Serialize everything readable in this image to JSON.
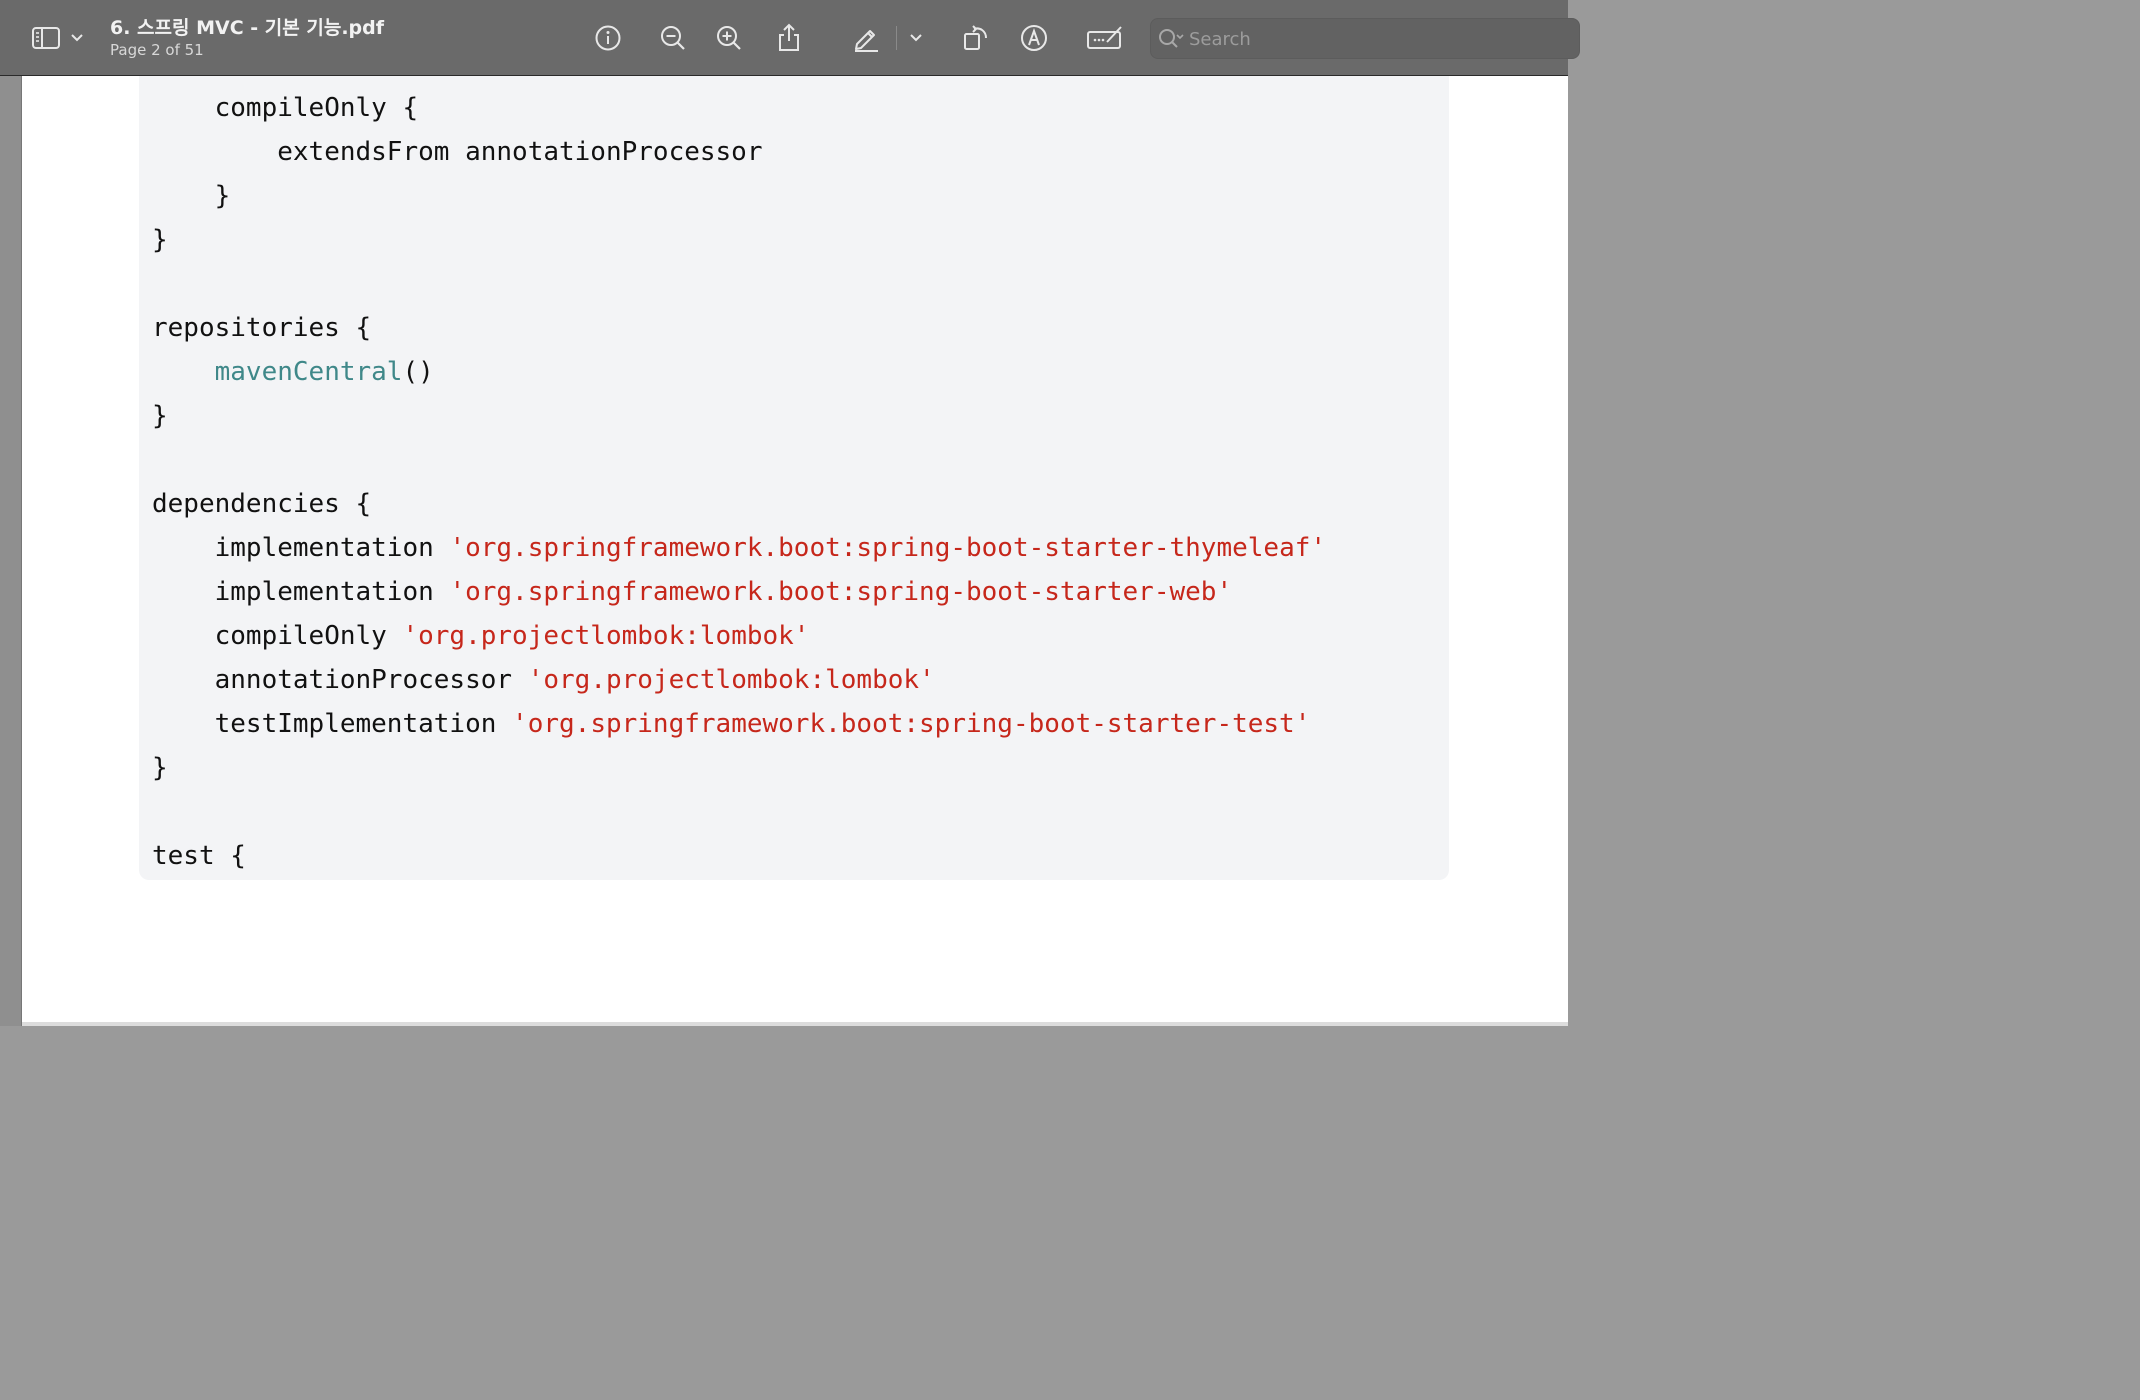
{
  "toolbar": {
    "document_title": "6. 스프링 MVC - 기본 기능.pdf",
    "page_indicator": "Page 2 of 51",
    "search_placeholder": "Search"
  },
  "code": {
    "lines": [
      {
        "indent": "    ",
        "parts": [
          {
            "text": "compileOnly {",
            "kind": "plain"
          }
        ]
      },
      {
        "indent": "        ",
        "parts": [
          {
            "text": "extendsFrom annotationProcessor",
            "kind": "plain"
          }
        ]
      },
      {
        "indent": "    ",
        "parts": [
          {
            "text": "}",
            "kind": "plain"
          }
        ]
      },
      {
        "indent": "",
        "parts": [
          {
            "text": "}",
            "kind": "plain"
          }
        ]
      },
      {
        "indent": "",
        "parts": [
          {
            "text": "repositories {",
            "kind": "plain"
          }
        ]
      },
      {
        "indent": "    ",
        "parts": [
          {
            "text": "mavenCentral",
            "kind": "fn"
          },
          {
            "text": "()",
            "kind": "plain"
          }
        ]
      },
      {
        "indent": "",
        "parts": [
          {
            "text": "}",
            "kind": "plain"
          }
        ]
      },
      {
        "indent": "",
        "parts": [
          {
            "text": "dependencies {",
            "kind": "plain"
          }
        ]
      },
      {
        "indent": "    ",
        "parts": [
          {
            "text": "implementation ",
            "kind": "plain"
          },
          {
            "text": "'org.springframework.boot:spring-boot-starter-thymeleaf'",
            "kind": "str"
          }
        ]
      },
      {
        "indent": "    ",
        "parts": [
          {
            "text": "implementation ",
            "kind": "plain"
          },
          {
            "text": "'org.springframework.boot:spring-boot-starter-web'",
            "kind": "str"
          }
        ]
      },
      {
        "indent": "    ",
        "parts": [
          {
            "text": "compileOnly ",
            "kind": "plain"
          },
          {
            "text": "'org.projectlombok:lombok'",
            "kind": "str"
          }
        ]
      },
      {
        "indent": "    ",
        "parts": [
          {
            "text": "annotationProcessor ",
            "kind": "plain"
          },
          {
            "text": "'org.projectlombok:lombok'",
            "kind": "str"
          }
        ]
      },
      {
        "indent": "    ",
        "parts": [
          {
            "text": "testImplementation ",
            "kind": "plain"
          },
          {
            "text": "'org.springframework.boot:spring-boot-starter-test'",
            "kind": "str"
          }
        ]
      },
      {
        "indent": "",
        "parts": [
          {
            "text": "}",
            "kind": "plain"
          }
        ]
      },
      {
        "indent": "",
        "parts": [
          {
            "text": "test {",
            "kind": "plain"
          }
        ]
      }
    ]
  },
  "colors": {
    "toolbar_bg": "#6a6a6a",
    "code_bg": "#f3f4f6",
    "function_color": "#3f8889",
    "string_color": "#c6271b"
  },
  "icons": [
    "sidebar-icon",
    "chevron-down-icon",
    "info-icon",
    "zoom-out-icon",
    "zoom-in-icon",
    "share-icon",
    "highlight-icon",
    "rotate-icon",
    "markup-icon",
    "signature-icon",
    "search-icon"
  ]
}
